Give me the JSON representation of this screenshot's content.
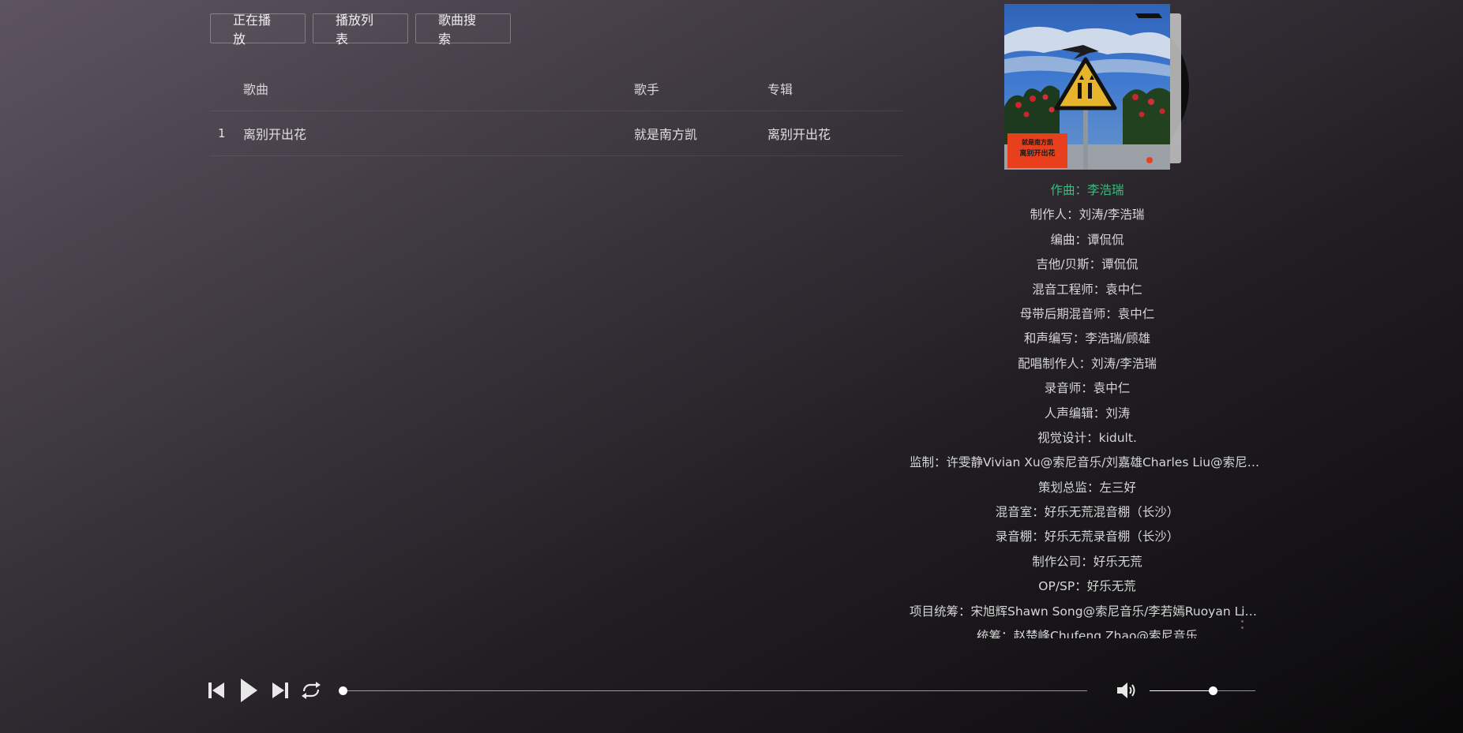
{
  "tabs": [
    "正在播放",
    "播放列表",
    "歌曲搜索"
  ],
  "table": {
    "headers": {
      "song": "歌曲",
      "artist": "歌手",
      "album": "专辑"
    },
    "rows": [
      {
        "index": "1",
        "song": "离别开出花",
        "artist": "就是南方凯",
        "album": "离别开出花"
      }
    ]
  },
  "album_cover": {
    "art_text": [
      "离别开出花",
      "就是南方凯"
    ]
  },
  "credits": {
    "active_index": 0,
    "active_color": "#31c27c",
    "lines": [
      "作曲：李浩瑞",
      "制作人：刘涛/李浩瑞",
      "编曲：谭侃侃",
      "吉他/贝斯：谭侃侃",
      "混音工程师：袁中仁",
      "母带后期混音师：袁中仁",
      "和声编写：李浩瑞/顾雄",
      "配唱制作人：刘涛/李浩瑞",
      "录音师：袁中仁",
      "人声编辑：刘涛",
      "视觉设计：kidult.",
      "监制：许雯静Vivian Xu@索尼音乐/刘嘉雄Charles Liu@索尼音乐",
      "策划总监：左三好",
      "混音室：好乐无荒混音棚（长沙）",
      "录音棚：好乐无荒录音棚（长沙）",
      "制作公司：好乐无荒",
      "OP/SP：好乐无荒",
      "项目统筹：宋旭辉Shawn Song@索尼音乐/李若嫣Ruoyan Li@索尼音乐",
      "统筹：赵楚峰Chufeng Zhao@索尼音乐"
    ]
  },
  "player": {
    "progress_fraction": 0.0,
    "volume_fraction": 0.6,
    "icons": [
      "prev-icon",
      "play-icon",
      "next-icon",
      "loop-icon",
      "volume-icon"
    ]
  }
}
